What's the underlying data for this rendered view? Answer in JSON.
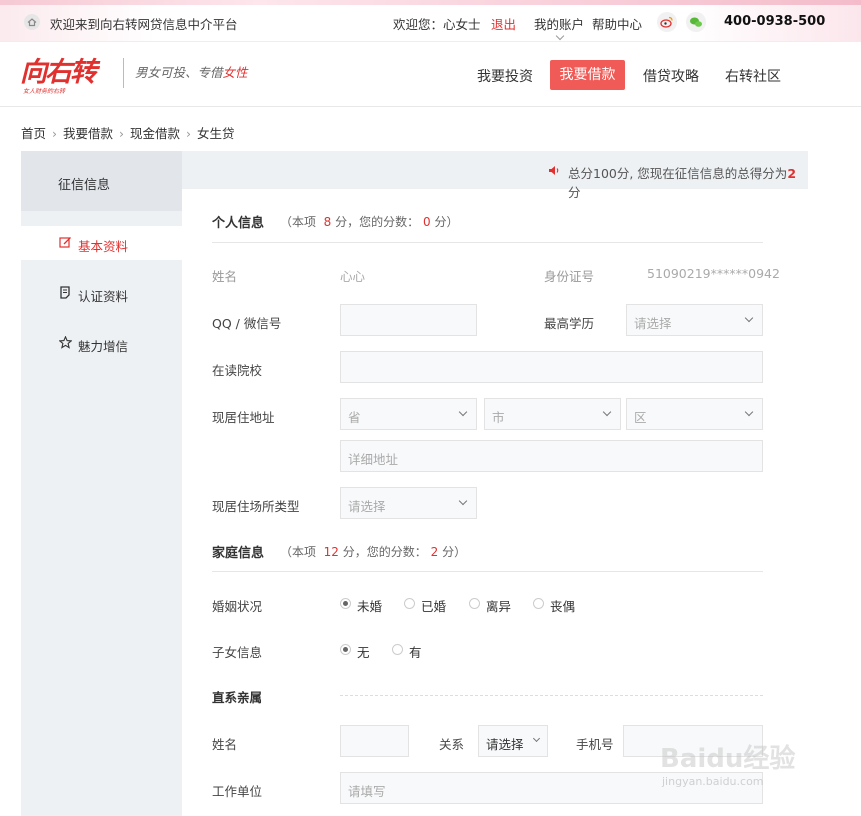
{
  "topbar": {
    "welcome": "欢迎来到向右转网贷信息中介平台",
    "hello": "欢迎您：心女士",
    "logout": "退出",
    "account": "我的账户",
    "help": "帮助中心",
    "phone": "400-0938-500"
  },
  "header": {
    "logo": "向右转",
    "logo_sub": "女人财务的右转",
    "slogan_a": "男女可投、专借",
    "slogan_b": "女性",
    "nav": [
      "我要投资",
      "我要借款",
      "借贷攻略",
      "右转社区"
    ]
  },
  "breadcrumb": [
    "首页",
    "我要借款",
    "现金借款",
    "女生贷"
  ],
  "sidebar": {
    "title": "征信信息",
    "items": [
      {
        "label": "基本资料",
        "icon": "edit-icon"
      },
      {
        "label": "认证资料",
        "icon": "document-icon"
      },
      {
        "label": "魅力增信",
        "icon": "star-icon"
      }
    ]
  },
  "notice": {
    "prefix": "总分100分, 您现在征信信息的总得分为",
    "score": "2",
    "suffix": "分"
  },
  "personal": {
    "title": "个人信息",
    "note_a": "（本项",
    "total": "8",
    "note_b": "分，您的分数：",
    "score": "0",
    "note_c": "分）",
    "name_label": "姓名",
    "name_value": "心心",
    "id_label": "身份证号",
    "id_value": "51090219******0942",
    "qq_label": "QQ / 微信号",
    "edu_label": "最高学历",
    "edu_placeholder": "请选择",
    "school_label": "在读院校",
    "addr_label": "现居住地址",
    "province": "省",
    "city": "市",
    "district": "区",
    "addr_detail": "详细地址",
    "housing_label": "现居住场所类型",
    "housing_placeholder": "请选择"
  },
  "family": {
    "title": "家庭信息",
    "note_a": "（本项",
    "total": "12",
    "note_b": "分，您的分数：",
    "score": "2",
    "note_c": "分）",
    "marital_label": "婚姻状况",
    "marital_options": [
      "未婚",
      "已婚",
      "离异",
      "丧偶"
    ],
    "marital_selected": "未婚",
    "children_label": "子女信息",
    "children_options": [
      "无",
      "有"
    ],
    "children_selected": "无",
    "relative_title": "直系亲属",
    "rel_name_label": "姓名",
    "rel_relation_label": "关系",
    "rel_relation_placeholder": "请选择",
    "rel_phone_label": "手机号",
    "work_label": "工作单位",
    "work_placeholder": "请填写"
  },
  "watermark": {
    "main": "Baidu经验",
    "sub": "jingyan.baidu.com"
  }
}
